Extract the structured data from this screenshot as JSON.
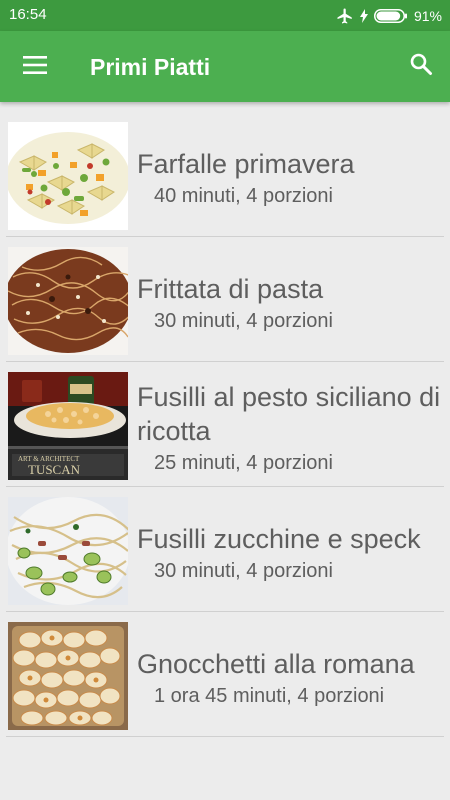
{
  "status_bar": {
    "time": "16:54",
    "battery_percent": "91%",
    "battery_level": 0.91,
    "icons": [
      "airplane-mode-icon",
      "charging-bolt-icon",
      "battery-icon"
    ]
  },
  "app_bar": {
    "title": "Primi Piatti",
    "menu_icon": "hamburger-menu-icon",
    "search_icon": "search-icon",
    "color": "#4caf50",
    "status_color": "#3d9a3f"
  },
  "recipes": [
    {
      "name": "Farfalle primavera",
      "meta": "40 minuti, 4 porzioni",
      "image": "farfalle-photo"
    },
    {
      "name": "Frittata di pasta",
      "meta": "30 minuti, 4 porzioni",
      "image": "frittata-photo"
    },
    {
      "name": "Fusilli al pesto siciliano di ricotta",
      "meta": "25 minuti, 4 porzioni",
      "image": "fusilli-pesto-photo"
    },
    {
      "name": "Fusilli zucchine e speck",
      "meta": "30 minuti, 4 porzioni",
      "image": "fusilli-zucchine-photo"
    },
    {
      "name": "Gnocchetti alla romana",
      "meta": "1 ora 45 minuti, 4 porzioni",
      "image": "gnocchetti-photo"
    }
  ]
}
